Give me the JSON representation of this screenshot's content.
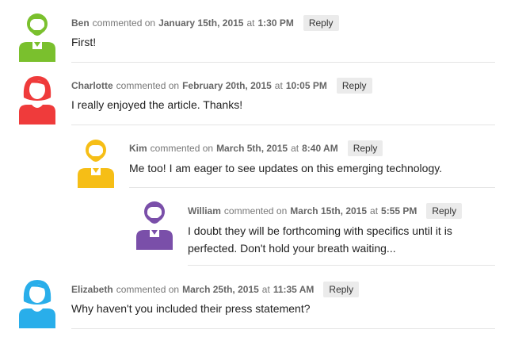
{
  "comments": [
    {
      "author": "Ben",
      "commented_on": "commented on",
      "date": "January 15th, 2015",
      "at": "at",
      "time": "1:30 PM",
      "reply_label": "Reply",
      "lines": [
        "First!"
      ],
      "avatar_color": "#7ac02d",
      "avatar_type": "male"
    },
    {
      "author": "Charlotte",
      "commented_on": "commented on",
      "date": "February 20th, 2015",
      "at": "at",
      "time": "10:05 PM",
      "reply_label": "Reply",
      "lines": [
        "I really enjoyed the article. Thanks!"
      ],
      "avatar_color": "#ef3b3b",
      "avatar_type": "female"
    },
    {
      "author": "Kim",
      "commented_on": "commented on",
      "date": "March 5th, 2015",
      "at": "at",
      "time": "8:40 AM",
      "reply_label": "Reply",
      "lines": [
        "Me too! I am eager to see updates on this emerging technology."
      ],
      "avatar_color": "#f6be16",
      "avatar_type": "male"
    },
    {
      "author": "William",
      "commented_on": "commented on",
      "date": "March 15th, 2015",
      "at": "at",
      "time": "5:55 PM",
      "reply_label": "Reply",
      "lines": [
        "I doubt they will be forthcoming with specifics until it is",
        "perfected. Don't hold your breath waiting..."
      ],
      "avatar_color": "#7a4fa9",
      "avatar_type": "male"
    },
    {
      "author": "Elizabeth",
      "commented_on": "commented on",
      "date": "March 25th, 2015",
      "at": "at",
      "time": "11:35 AM",
      "reply_label": "Reply",
      "lines": [
        "Why haven't you included their press statement?"
      ],
      "avatar_color": "#29aeea",
      "avatar_type": "female"
    }
  ]
}
